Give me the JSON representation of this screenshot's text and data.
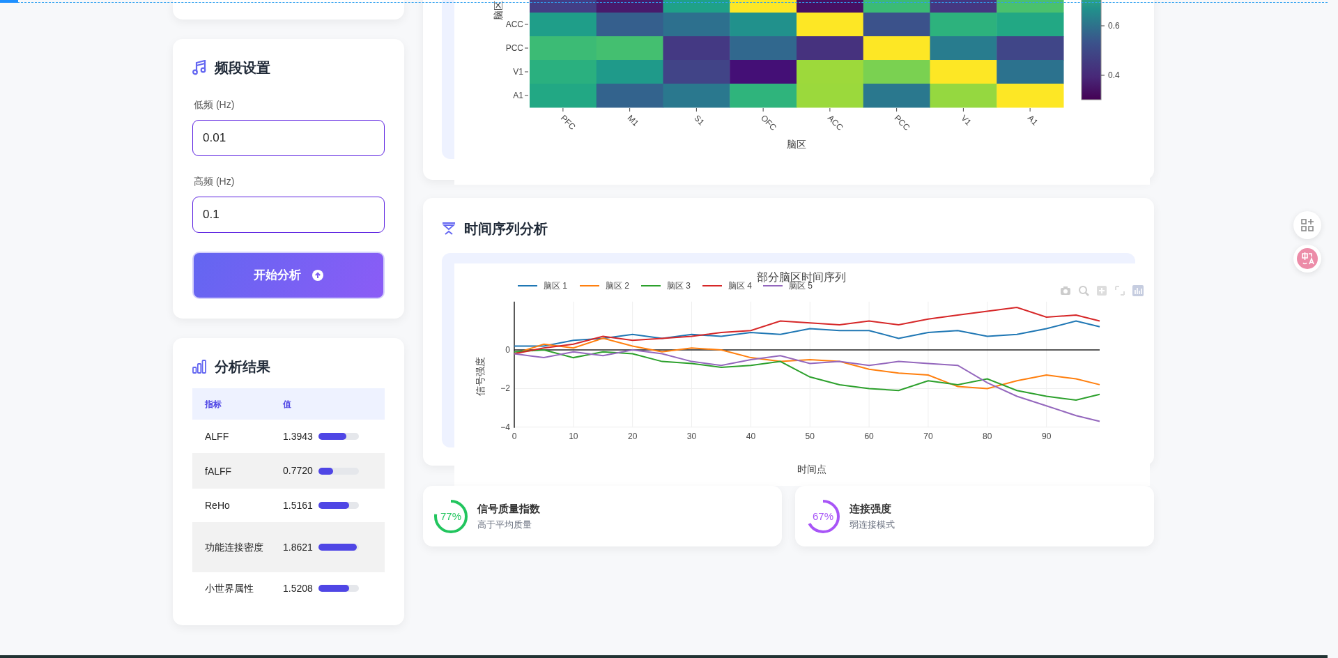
{
  "frequency_card": {
    "title": "频段设置",
    "fields": [
      {
        "label": "低频 (Hz)",
        "value": "0.01"
      },
      {
        "label": "高频 (Hz)",
        "value": "0.1"
      }
    ],
    "button": "开始分析"
  },
  "results_card": {
    "title": "分析结果",
    "columns": [
      "指标",
      "值"
    ],
    "rows": [
      {
        "name": "ALFF",
        "value": "1.3943",
        "level": 0.7
      },
      {
        "name": "fALFF",
        "value": "0.7720",
        "level": 0.37
      },
      {
        "name": "ReHo",
        "value": "1.5161",
        "level": 0.76
      },
      {
        "name": "功能连接密度",
        "value": "1.8621",
        "level": 0.95
      },
      {
        "name": "小世界属性",
        "value": "1.5208",
        "level": 0.76
      }
    ]
  },
  "heatmap_card": {
    "y_axis_title": "脑区",
    "row_labels": [
      "ACC",
      "PCC",
      "V1",
      "A1"
    ],
    "column_labels": [
      "PFC",
      "M1",
      "S1",
      "OFC",
      "ACC",
      "PCC",
      "V1",
      "A1"
    ],
    "x_axis_title": "脑区",
    "colorbar_ticks": [
      "0.6",
      "0.4"
    ]
  },
  "timeseries_card": {
    "title": "时间序列分析",
    "chart_data": {
      "type": "line",
      "title": "部分脑区时间序列",
      "xlabel": "时间点",
      "ylabel": "信号强度",
      "x": [
        0,
        5,
        10,
        15,
        20,
        25,
        30,
        35,
        40,
        45,
        50,
        55,
        60,
        65,
        70,
        75,
        80,
        85,
        90,
        95,
        99
      ],
      "series": [
        {
          "name": "脑区 1",
          "color": "#1f77b4",
          "values": [
            0.2,
            0.2,
            0.5,
            0.6,
            0.8,
            0.6,
            0.8,
            0.7,
            0.9,
            0.8,
            1.1,
            1.0,
            1.0,
            0.6,
            0.9,
            1.0,
            0.7,
            0.8,
            1.1,
            1.5,
            1.2
          ]
        },
        {
          "name": "脑区 2",
          "color": "#ff7f0e",
          "values": [
            -0.2,
            0.3,
            0.1,
            0.6,
            0.2,
            -0.1,
            0.1,
            0,
            -0.4,
            -0.6,
            -0.5,
            -0.6,
            -1.0,
            -1.2,
            -1.3,
            -1.9,
            -2.0,
            -1.6,
            -1.3,
            -1.5,
            -1.8
          ]
        },
        {
          "name": "脑区 3",
          "color": "#2ca02c",
          "values": [
            -0.1,
            0,
            -0.4,
            -0.1,
            -0.2,
            -0.6,
            -0.7,
            -0.9,
            -0.8,
            -0.6,
            -1.4,
            -1.8,
            -2.0,
            -2.1,
            -1.6,
            -1.8,
            -1.5,
            -2.1,
            -2.4,
            -2.6,
            -2.3
          ]
        },
        {
          "name": "脑区 4",
          "color": "#d62728",
          "values": [
            -0.2,
            0.1,
            0.3,
            0.7,
            0.5,
            0.6,
            0.7,
            0.9,
            1.0,
            1.5,
            1.4,
            1.3,
            1.5,
            1.3,
            1.6,
            1.8,
            2.0,
            2.2,
            1.7,
            1.8,
            1.5
          ]
        },
        {
          "name": "脑区 5",
          "color": "#9467bd",
          "values": [
            -0.2,
            -0.4,
            -0.1,
            -0.3,
            0,
            -0.2,
            -0.6,
            -0.8,
            -0.5,
            -0.3,
            -0.7,
            -0.6,
            -0.8,
            -0.6,
            -0.7,
            -0.8,
            -1.7,
            -2.4,
            -2.9,
            -3.4,
            -3.7
          ]
        }
      ],
      "xlim": [
        0,
        99
      ],
      "ylim": [
        -4,
        2.5
      ],
      "grid": true,
      "legend": "top",
      "xticks": [
        0,
        10,
        20,
        30,
        40,
        50,
        60,
        70,
        80,
        90
      ],
      "yticks": [
        -4,
        -2,
        0
      ]
    }
  },
  "stats": [
    {
      "percent": "77%",
      "level": 0.77,
      "color": "#22c55e",
      "title": "信号质量指数",
      "subtitle": "高于平均质量"
    },
    {
      "percent": "67%",
      "level": 0.67,
      "color": "#a855f7",
      "title": "连接强度",
      "subtitle": "弱连接模式"
    }
  ]
}
